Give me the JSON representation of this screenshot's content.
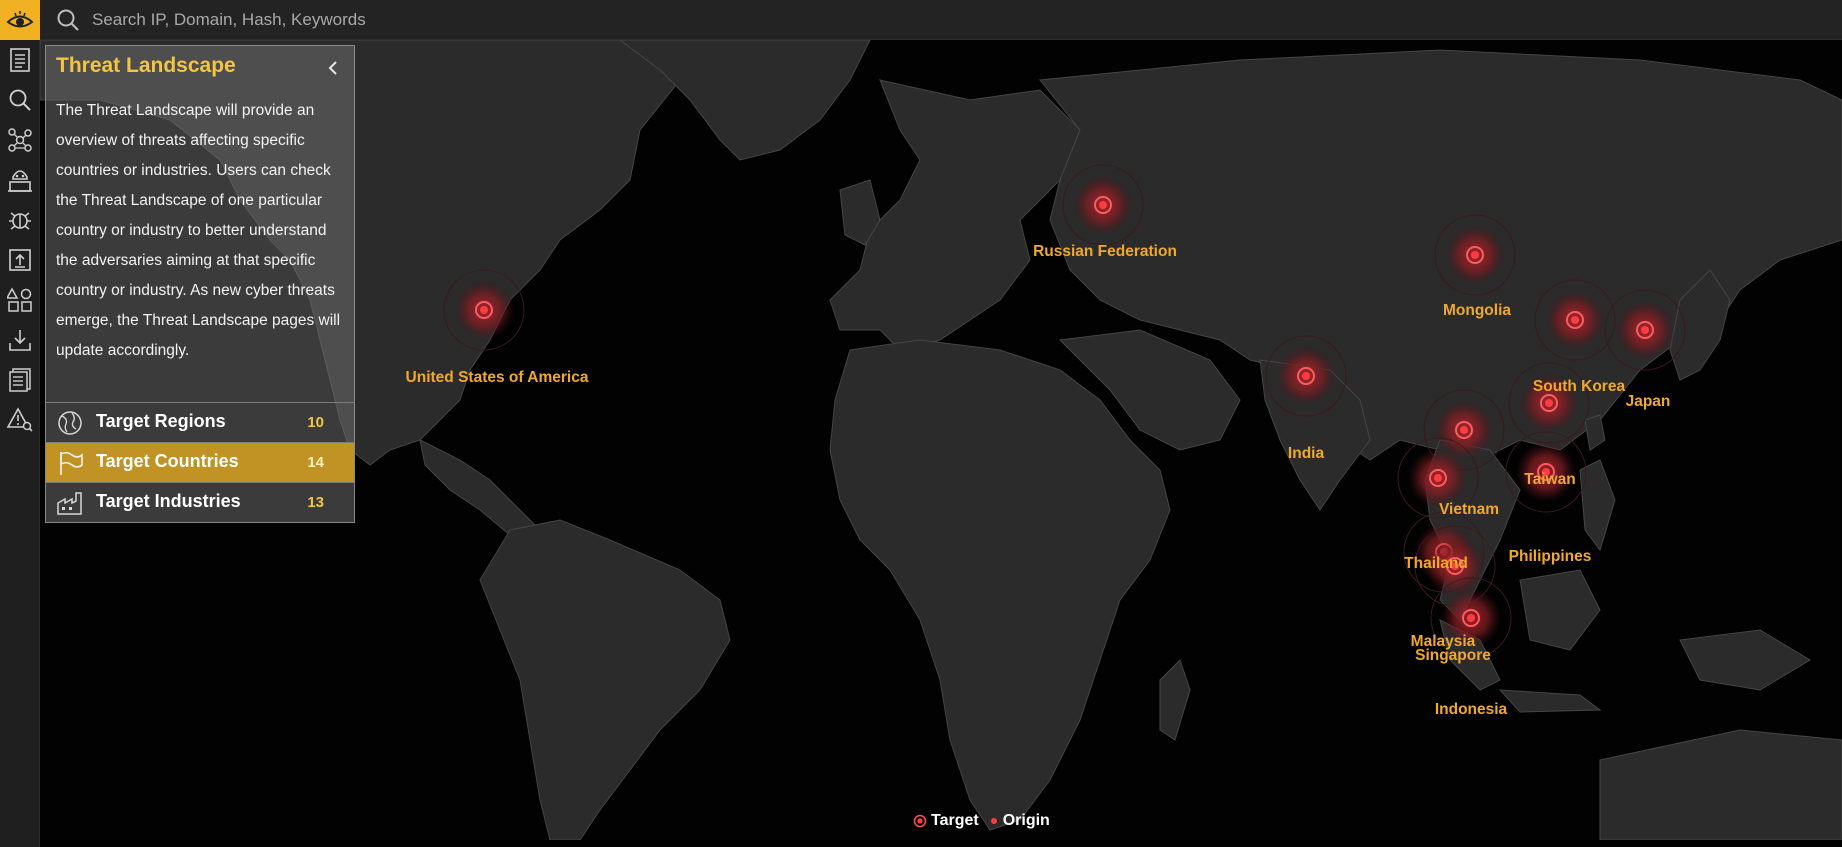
{
  "search": {
    "placeholder": "Search IP, Domain, Hash, Keywords"
  },
  "rail": {
    "items": [
      {
        "icon": "document-list-icon"
      },
      {
        "icon": "search-icon"
      },
      {
        "icon": "network-graph-icon"
      },
      {
        "icon": "hacker-icon"
      },
      {
        "icon": "bug-icon"
      },
      {
        "icon": "upload-icon"
      },
      {
        "icon": "shapes-icon"
      },
      {
        "icon": "download-icon"
      },
      {
        "icon": "reports-icon"
      },
      {
        "icon": "alert-search-icon"
      }
    ]
  },
  "panel": {
    "title": "Threat Landscape",
    "description": "The Threat Landscape will provide an overview of threats affecting specific countries or industries. Users can check the Threat Landscape of one particular country or industry to better understand the adversaries aiming at that specific country or industry. As new cyber threats emerge, the Threat Landscape pages will update accordingly.",
    "rows": [
      {
        "label": "Target Regions",
        "count": "10",
        "icon": "globe-icon",
        "active": false
      },
      {
        "label": "Target Countries",
        "count": "14",
        "icon": "flag-icon",
        "active": true
      },
      {
        "label": "Target Industries",
        "count": "13",
        "icon": "factory-icon",
        "active": false
      }
    ]
  },
  "countries": [
    "Russian Federation",
    "United States of America",
    "Mongolia",
    "South Korea",
    "Japan",
    "India",
    "Taiwan",
    "Vietnam",
    "Philippines",
    "Thailand",
    "Malaysia",
    "Singapore",
    "Indonesia"
  ],
  "legend": {
    "target_label": "Target",
    "origin_label": "Origin"
  },
  "colors": {
    "accent": "#f0b222",
    "label": "#f1a92a",
    "marker": "#e8343c",
    "land": "#2e2e2e",
    "ocean": "#020202"
  }
}
